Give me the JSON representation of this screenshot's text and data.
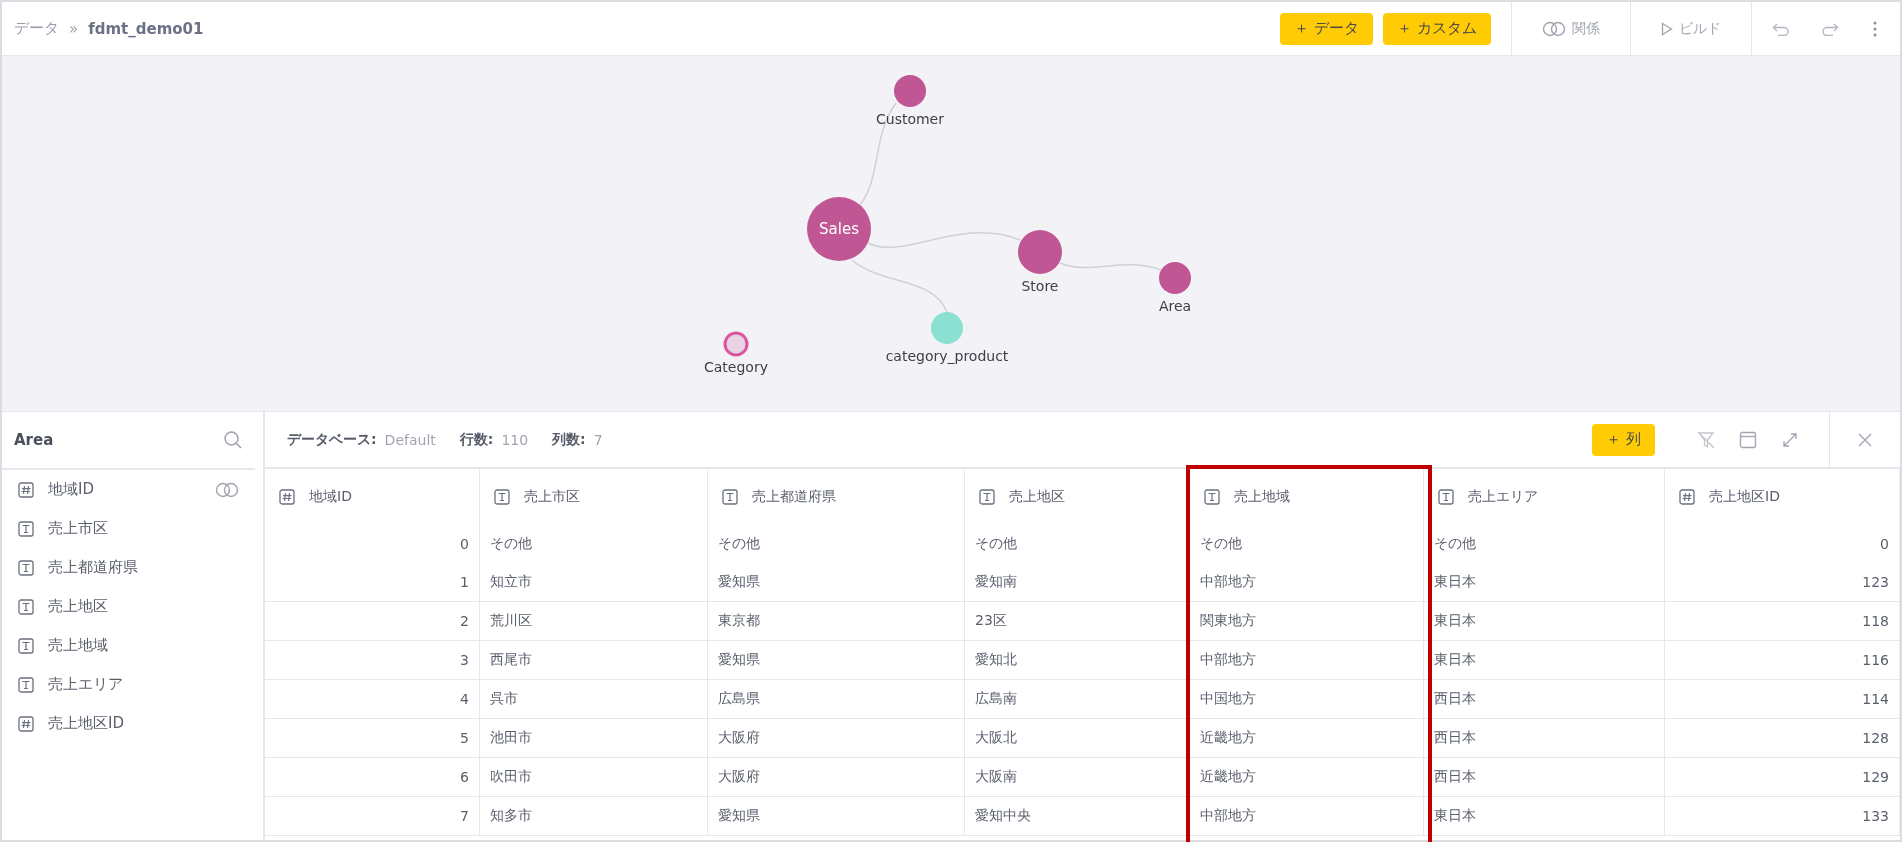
{
  "breadcrumb": {
    "root": "データ",
    "separator": "»",
    "current": "fdmt_demo01"
  },
  "toolbar": {
    "add_buttons": [
      {
        "icon": "＋",
        "label": "データ"
      },
      {
        "icon": "＋",
        "label": "カスタム"
      }
    ],
    "relation": {
      "label": "関係"
    },
    "build": {
      "label": "ビルド"
    }
  },
  "graph": {
    "nodes": [
      {
        "name": "Customer",
        "color": "#c05694",
        "kind": "small"
      },
      {
        "name": "Sales",
        "color": "#c05694",
        "kind": "large"
      },
      {
        "name": "Store",
        "color": "#c05694",
        "kind": "medium"
      },
      {
        "name": "Area",
        "color": "#c05694",
        "kind": "small"
      },
      {
        "name": "category_product",
        "color": "#8ce0d2",
        "kind": "small"
      },
      {
        "name": "Category",
        "color": "#e8d2e4",
        "kind": "hollow"
      }
    ]
  },
  "field_panel": {
    "title": "Area",
    "fields": [
      {
        "name": "地域ID",
        "kind": "number",
        "related": true
      },
      {
        "name": "売上市区",
        "kind": "text",
        "related": false
      },
      {
        "name": "売上都道府県",
        "kind": "text",
        "related": false
      },
      {
        "name": "売上地区",
        "kind": "text",
        "related": false
      },
      {
        "name": "売上地域",
        "kind": "text",
        "related": false
      },
      {
        "name": "売上エリア",
        "kind": "text",
        "related": false
      },
      {
        "name": "売上地区ID",
        "kind": "number",
        "related": false
      }
    ]
  },
  "table_info": [
    {
      "label": "データベース:",
      "value": "Default"
    },
    {
      "label": "行数:",
      "value": "110"
    },
    {
      "label": "列数:",
      "value": "7"
    }
  ],
  "add_column": {
    "icon": "＋",
    "label": "列"
  },
  "table": {
    "columns": [
      {
        "name": "地域ID",
        "kind": "number",
        "highlighted": false
      },
      {
        "name": "売上市区",
        "kind": "text",
        "highlighted": false
      },
      {
        "name": "売上都道府県",
        "kind": "text",
        "highlighted": false
      },
      {
        "name": "売上地区",
        "kind": "text",
        "highlighted": false
      },
      {
        "name": "売上地域",
        "kind": "text",
        "highlighted": true
      },
      {
        "name": "売上エリア",
        "kind": "text",
        "highlighted": false
      },
      {
        "name": "売上地区ID",
        "kind": "number",
        "highlighted": false
      }
    ],
    "rows": [
      [
        "0",
        "その他",
        "その他",
        "その他",
        "その他",
        "その他",
        "0"
      ],
      [
        "1",
        "知立市",
        "愛知県",
        "愛知南",
        "中部地方",
        "東日本",
        "123"
      ],
      [
        "2",
        "荒川区",
        "東京都",
        "23区",
        "関東地方",
        "東日本",
        "118"
      ],
      [
        "3",
        "西尾市",
        "愛知県",
        "愛知北",
        "中部地方",
        "東日本",
        "116"
      ],
      [
        "4",
        "呉市",
        "広島県",
        "広島南",
        "中国地方",
        "西日本",
        "114"
      ],
      [
        "5",
        "池田市",
        "大阪府",
        "大阪北",
        "近畿地方",
        "西日本",
        "128"
      ],
      [
        "6",
        "吹田市",
        "大阪府",
        "大阪南",
        "近畿地方",
        "西日本",
        "129"
      ],
      [
        "7",
        "知多市",
        "愛知県",
        "愛知中央",
        "中部地方",
        "東日本",
        "133"
      ]
    ]
  }
}
